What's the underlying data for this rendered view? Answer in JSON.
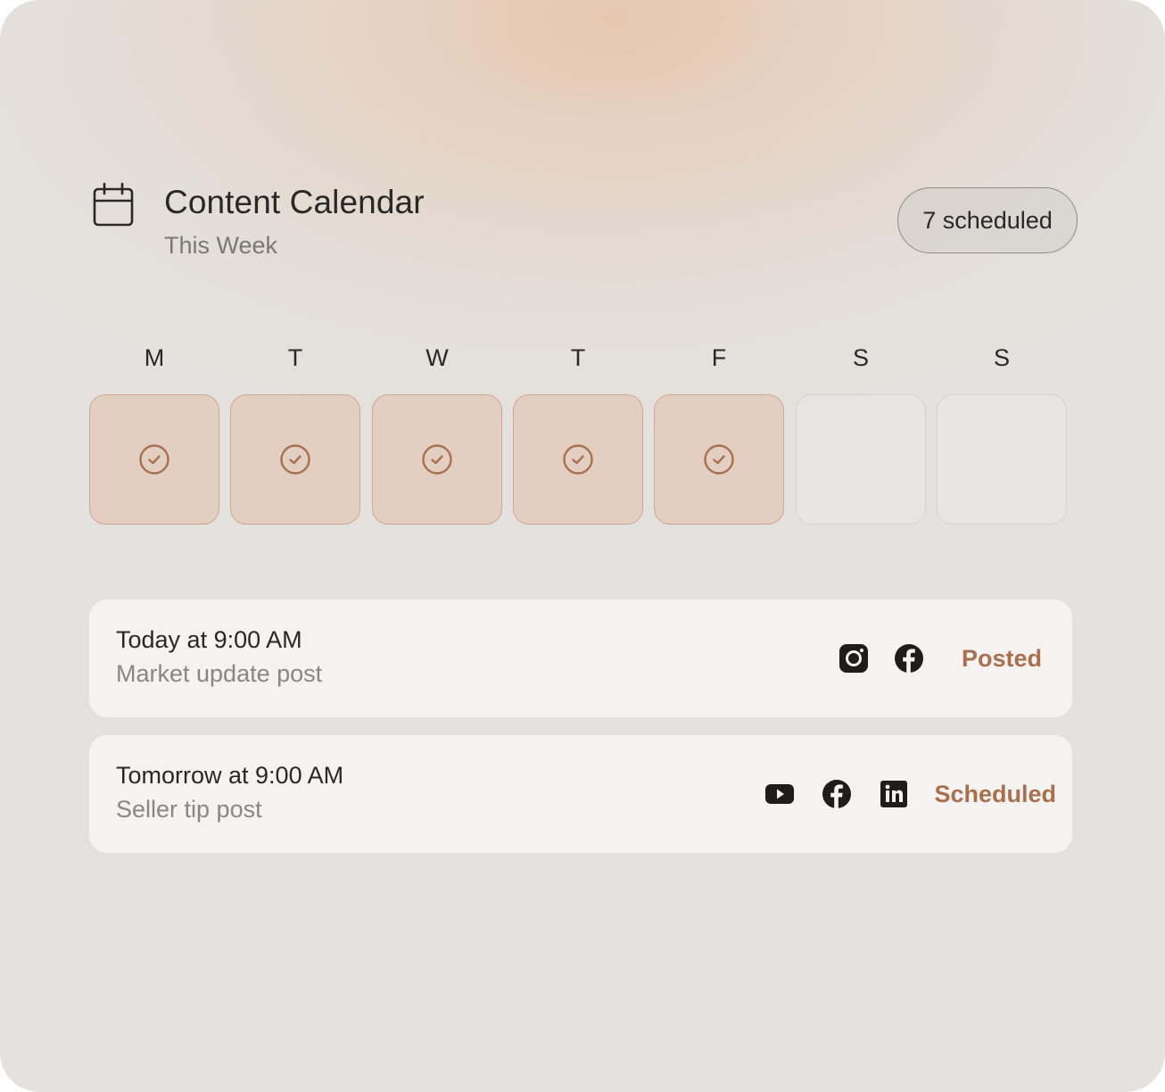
{
  "header": {
    "title": "Content Calendar",
    "subtitle": "This Week",
    "badge": "7 scheduled"
  },
  "week": {
    "days": [
      {
        "label": "M",
        "done": true
      },
      {
        "label": "T",
        "done": true
      },
      {
        "label": "W",
        "done": true
      },
      {
        "label": "T",
        "done": true
      },
      {
        "label": "F",
        "done": true
      },
      {
        "label": "S",
        "done": false
      },
      {
        "label": "S",
        "done": false
      }
    ]
  },
  "posts": [
    {
      "time": "Today at 9:00 AM",
      "description": "Market update post",
      "platforms": [
        "instagram-icon",
        "facebook-icon"
      ],
      "status": "Posted"
    },
    {
      "time": "Tomorrow at 9:00 AM",
      "description": "Seller tip post",
      "platforms": [
        "youtube-icon",
        "facebook-icon",
        "linkedin-icon"
      ],
      "status": "Scheduled"
    }
  ],
  "colors": {
    "accent": "#a9704e",
    "done_fill": "#e2cfc2",
    "done_border": "#cfa790",
    "text_primary": "#2a2826",
    "text_secondary": "#7b7773"
  }
}
